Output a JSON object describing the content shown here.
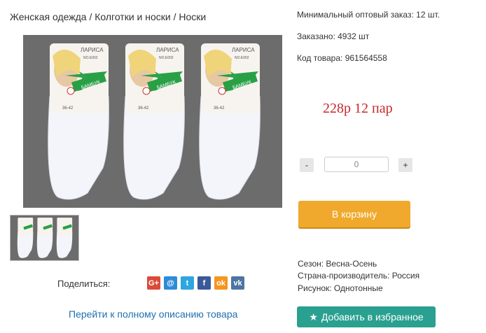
{
  "breadcrumb": "Женская одежда / Колготки и носки / Носки",
  "product": {
    "min_order": "Минимальный оптовый заказ: 12 шт.",
    "ordered": "Заказано: 4932 шт",
    "code": "Код товара: 961564558",
    "price": "228р 12 пар",
    "quantity_value": "0",
    "qty_minus": "-",
    "qty_plus": "+",
    "cart_label": "В корзину",
    "season": "Сезон: Весна-Осень",
    "country": "Страна-производитель: Россия",
    "pattern": "Рисунок: Однотонные",
    "favorite_label": "Добавить в избранное"
  },
  "packaging": {
    "brand": "ЛАРИСА",
    "code": "NO.E002",
    "material": "БАМБУК",
    "size": "36-42"
  },
  "share": {
    "label": "Поделиться:",
    "icons": [
      {
        "name": "google-plus-icon",
        "glyph": "G+",
        "color": "#dc4a38"
      },
      {
        "name": "mail-icon",
        "glyph": "@",
        "color": "#2d8bd8"
      },
      {
        "name": "twitter-icon",
        "glyph": "t",
        "color": "#2ea6e0"
      },
      {
        "name": "facebook-icon",
        "glyph": "f",
        "color": "#3b5998"
      },
      {
        "name": "odnoklassniki-icon",
        "glyph": "ok",
        "color": "#f4951f"
      },
      {
        "name": "vk-icon",
        "glyph": "vk",
        "color": "#4c75a3"
      }
    ]
  },
  "full_description_link": "Перейти к полному описанию товара",
  "colors": {
    "price": "#c62828",
    "cart_button": "#f0a92c",
    "favorite_button": "#2aa090",
    "link": "#1f6fae"
  }
}
